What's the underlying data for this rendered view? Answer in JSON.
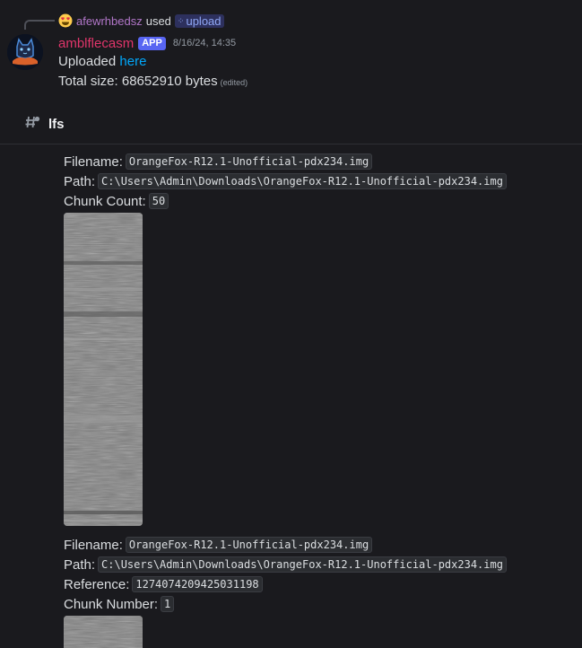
{
  "reply": {
    "emoji_icon": "heart-eyes-emoji-icon",
    "username": "afewrhbedsz",
    "used_text": "used",
    "command_icon": "slash-command-icon",
    "command": "upload"
  },
  "message": {
    "username": "amblflecasm",
    "badge": "APP",
    "timestamp": "8/16/24, 14:35",
    "uploaded_prefix": "Uploaded",
    "uploaded_link": "here",
    "total_size": "Total size: 68652910 bytes",
    "edited": "(edited)"
  },
  "thread": {
    "icon": "thread-hash-icon",
    "name": "lfs"
  },
  "first_post": {
    "filename_label": "Filename:",
    "filename": "OrangeFox-R12.1-Unofficial-pdx234.img",
    "path_label": "Path:",
    "path": "C:\\Users\\Admin\\Downloads\\OrangeFox-R12.1-Unofficial-pdx234.img",
    "chunk_count_label": "Chunk Count:",
    "chunk_count": "50"
  },
  "second_post": {
    "filename_label": "Filename:",
    "filename": "OrangeFox-R12.1-Unofficial-pdx234.img",
    "path_label": "Path:",
    "path": "C:\\Users\\Admin\\Downloads\\OrangeFox-R12.1-Unofficial-pdx234.img",
    "reference_label": "Reference:",
    "reference": "1274074209425031198",
    "chunk_number_label": "Chunk Number:",
    "chunk_number": "1"
  },
  "colors": {
    "background": "#1a1a1e",
    "username": "#e0356a",
    "reply_user": "#b176c8",
    "link": "#00a8fc",
    "badge": "#5865f2"
  }
}
